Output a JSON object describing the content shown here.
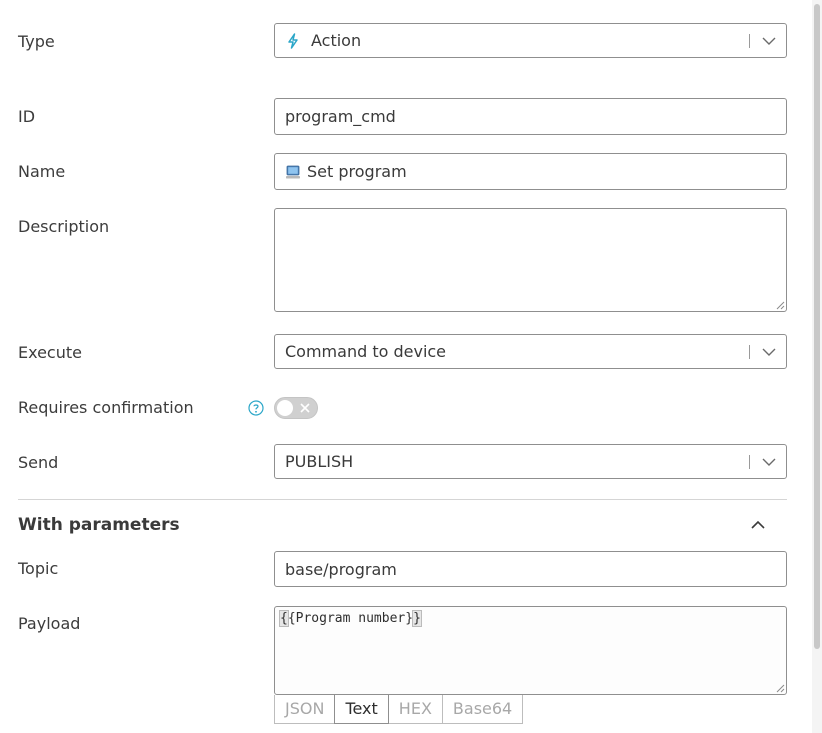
{
  "form": {
    "type": {
      "label": "Type",
      "value": "Action",
      "icon": "lightning-icon"
    },
    "id": {
      "label": "ID",
      "value": "program_cmd"
    },
    "name": {
      "label": "Name",
      "value": "Set program",
      "icon": "computer-icon"
    },
    "description": {
      "label": "Description",
      "value": ""
    },
    "execute": {
      "label": "Execute",
      "value": "Command to device"
    },
    "requires_confirmation": {
      "label": "Requires confirmation",
      "enabled": false
    },
    "send": {
      "label": "Send",
      "value": "PUBLISH"
    }
  },
  "parameters": {
    "title": "With parameters",
    "topic": {
      "label": "Topic",
      "value": "base/program"
    },
    "payload": {
      "label": "Payload",
      "open": "{",
      "body": "{Program number}",
      "close": "}",
      "formats": [
        "JSON",
        "Text",
        "HEX",
        "Base64"
      ],
      "selected_format": "Text"
    }
  },
  "colors": {
    "accent": "#2aa6c8",
    "border": "#8f8f8f",
    "toggle_off": "#d0d0d0"
  }
}
